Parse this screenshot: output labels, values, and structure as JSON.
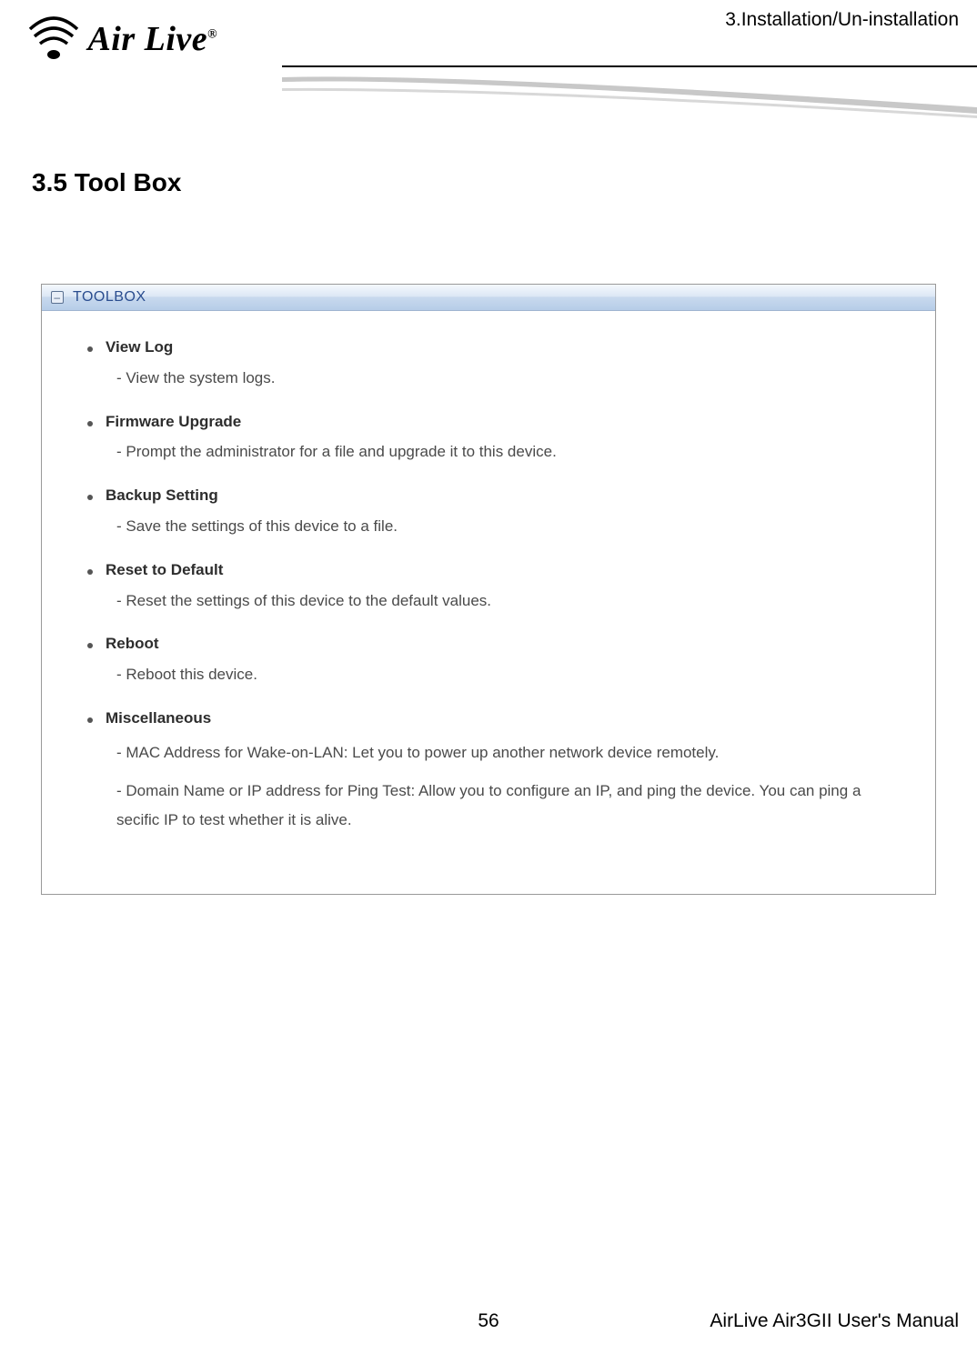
{
  "header": {
    "chapter": "3.Installation/Un-installation",
    "logo_text": "Air Live",
    "logo_reg": "®"
  },
  "section": {
    "title": "3.5 Tool Box"
  },
  "panel": {
    "title": "TOOLBOX",
    "collapse_icon": "–",
    "items": [
      {
        "title": "View Log",
        "desc": [
          "- View the system logs."
        ]
      },
      {
        "title": "Firmware Upgrade",
        "desc": [
          "- Prompt the administrator for a file and upgrade it to this device."
        ]
      },
      {
        "title": "Backup Setting",
        "desc": [
          "- Save the settings of this device to a file."
        ]
      },
      {
        "title": "Reset to Default",
        "desc": [
          "- Reset the settings of this device to the default values."
        ]
      },
      {
        "title": "Reboot",
        "desc": [
          "- Reboot this device."
        ]
      },
      {
        "title": "Miscellaneous",
        "desc": [
          "- MAC Address for Wake-on-LAN: Let you to power up another network device remotely.",
          "- Domain Name or IP address for Ping Test: Allow you to configure an IP, and ping the device. You can ping a secific IP to test whether it is alive."
        ]
      }
    ]
  },
  "footer": {
    "page": "56",
    "manual": "AirLive Air3GII User's Manual"
  }
}
